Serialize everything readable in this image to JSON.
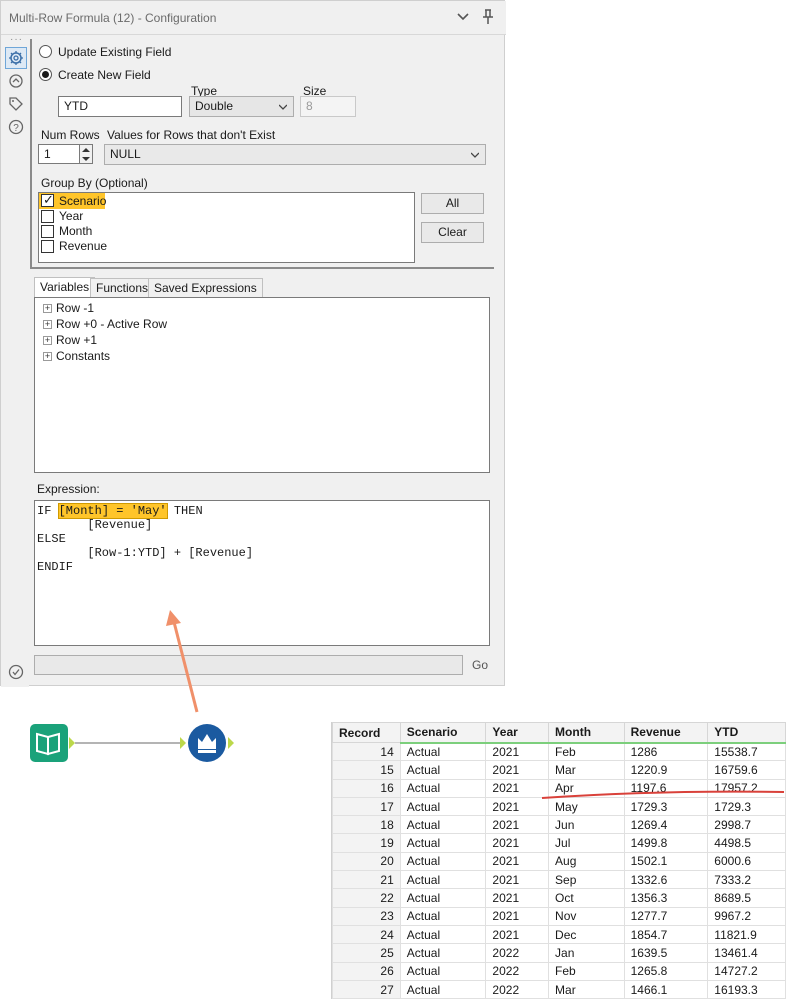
{
  "window": {
    "title": "Multi-Row Formula (12) - Configuration"
  },
  "options": {
    "update_existing": "Update Existing Field",
    "create_new": "Create New  Field",
    "new_field_name": "YTD",
    "type_label": "Type",
    "type_value": "Double",
    "size_label": "Size",
    "size_value": "8",
    "num_rows_label": "Num Rows",
    "num_rows_value": "1",
    "nonexist_label": "Values for Rows that don't Exist",
    "nonexist_value": "NULL"
  },
  "group_by": {
    "label": "Group By (Optional)",
    "items": [
      {
        "label": "Scenario",
        "checked": true
      },
      {
        "label": "Year",
        "checked": false
      },
      {
        "label": "Month",
        "checked": false
      },
      {
        "label": "Revenue",
        "checked": false
      }
    ],
    "all_button": "All",
    "clear_button": "Clear"
  },
  "tabs": [
    "Variables",
    "Functions",
    "Saved Expressions"
  ],
  "variables_tree": [
    "Row -1",
    "Row +0 - Active Row",
    "Row +1",
    "Constants"
  ],
  "expression": {
    "label": "Expression:",
    "line1_prefix": "IF ",
    "line1_highlight": "[Month] = 'May'",
    "line1_suffix": " THEN",
    "line2": "       [Revenue]",
    "line3": "ELSE",
    "line4": "       [Row-1:YTD] + [Revenue]",
    "line5": "ENDIF"
  },
  "go_button": "Go",
  "grid": {
    "columns": [
      "Record",
      "Scenario",
      "Year",
      "Month",
      "Revenue",
      "YTD"
    ],
    "rows": [
      [
        "14",
        "Actual",
        "2021",
        "Feb",
        "1286",
        "15538.7"
      ],
      [
        "15",
        "Actual",
        "2021",
        "Mar",
        "1220.9",
        "16759.6"
      ],
      [
        "16",
        "Actual",
        "2021",
        "Apr",
        "1197.6",
        "17957.2"
      ],
      [
        "17",
        "Actual",
        "2021",
        "May",
        "1729.3",
        "1729.3"
      ],
      [
        "18",
        "Actual",
        "2021",
        "Jun",
        "1269.4",
        "2998.7"
      ],
      [
        "19",
        "Actual",
        "2021",
        "Jul",
        "1499.8",
        "4498.5"
      ],
      [
        "20",
        "Actual",
        "2021",
        "Aug",
        "1502.1",
        "6000.6"
      ],
      [
        "21",
        "Actual",
        "2021",
        "Sep",
        "1332.6",
        "7333.2"
      ],
      [
        "22",
        "Actual",
        "2021",
        "Oct",
        "1356.3",
        "8689.5"
      ],
      [
        "23",
        "Actual",
        "2021",
        "Nov",
        "1277.7",
        "9967.2"
      ],
      [
        "24",
        "Actual",
        "2021",
        "Dec",
        "1854.7",
        "11821.9"
      ],
      [
        "25",
        "Actual",
        "2022",
        "Jan",
        "1639.5",
        "13461.4"
      ],
      [
        "26",
        "Actual",
        "2022",
        "Feb",
        "1265.8",
        "14727.2"
      ],
      [
        "27",
        "Actual",
        "2022",
        "Mar",
        "1466.1",
        "16193.3"
      ]
    ]
  },
  "colors": {
    "highlight": "#ffc52a",
    "arrow": "#f0906a",
    "underline": "#d9413a",
    "tool_input": "#1aa27a",
    "tool_multirow": "#1b5aa0",
    "connector": "#bcd84a"
  }
}
